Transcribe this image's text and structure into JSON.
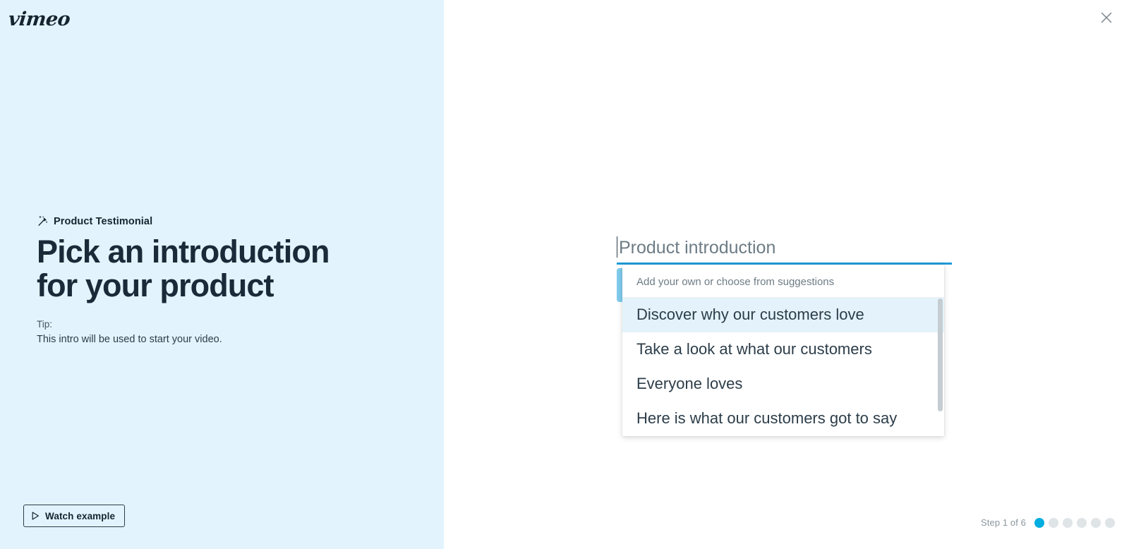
{
  "brand": {
    "logo_text": "vimeo",
    "accent_blue": "#00ade0",
    "underline_blue": "#1d9bd6",
    "panel_bg": "#e2f3fd",
    "highlight_bg": "#e4f3fb"
  },
  "left_panel": {
    "template_icon": "magic-wand-icon",
    "template_label": "Product Testimonial",
    "headline": "Pick an introduction\nfor your product",
    "tip_label": "Tip:",
    "tip_text": "This intro will be used to start your video.",
    "watch_example": {
      "icon": "play-icon",
      "label": "Watch example"
    }
  },
  "right_panel": {
    "close_icon": "close-icon",
    "answer_field": {
      "value": "",
      "placeholder": "Product introduction",
      "caret_visible": true
    },
    "suggestions": {
      "hint": "Add your own or choose from suggestions",
      "items": [
        {
          "label": "Discover why our customers love",
          "active": true
        },
        {
          "label": "Take a look at what our customers",
          "active": false
        },
        {
          "label": "Everyone loves",
          "active": false
        },
        {
          "label": "Here is what our customers got to say",
          "active": false
        }
      ],
      "scrollbar_visible": true
    },
    "step_indicator": {
      "label": "Step 1 of 6",
      "current": 1,
      "total": 6,
      "dots": [
        {
          "active": true
        },
        {
          "active": false
        },
        {
          "active": false
        },
        {
          "active": false
        },
        {
          "active": false
        },
        {
          "active": false
        }
      ]
    }
  }
}
